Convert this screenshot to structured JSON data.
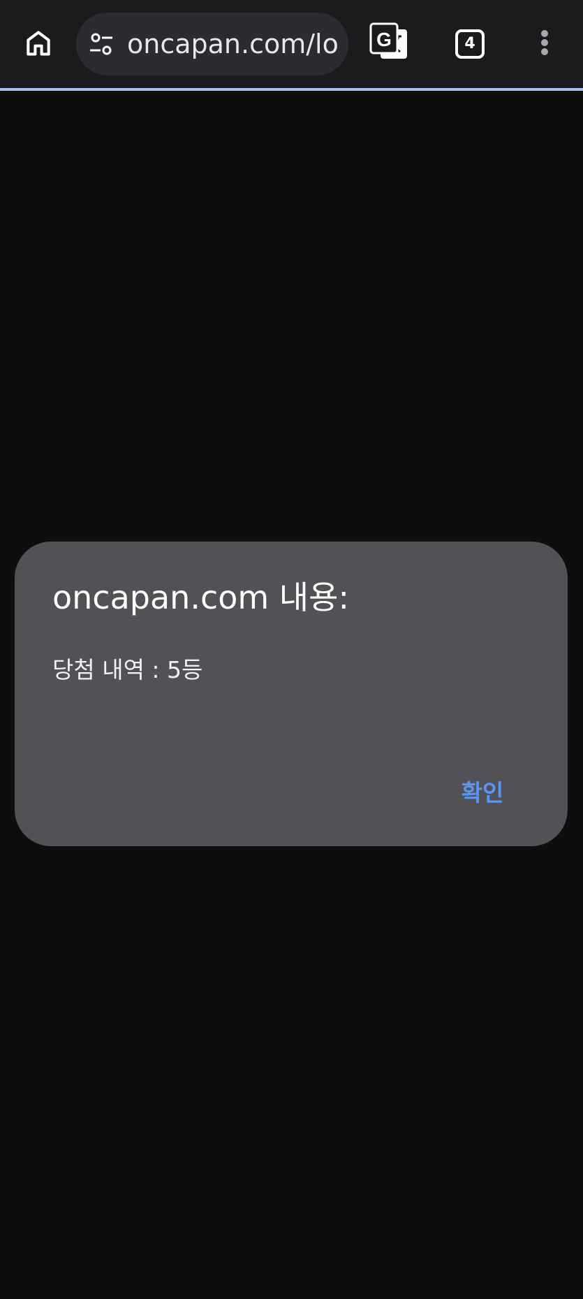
{
  "browser": {
    "url": "oncapan.com/lo",
    "tab_count": "4",
    "icons": {
      "home": "home-icon",
      "site_settings": "tune-icon",
      "translate": "translate-icon",
      "tabs": "tab-switcher-icon",
      "menu": "more-vert-icon"
    },
    "progress_fraction": 1.0
  },
  "dialog": {
    "title": "oncapan.com 내용:",
    "message": "당첨 내역 : 5등",
    "ok_label": "확인"
  },
  "colors": {
    "toolbar_bg": "#1b1b1d",
    "page_bg": "#0e0e0f",
    "dialog_bg": "#525256",
    "accent": "#5a95f5",
    "progress": "#a8c1f5"
  }
}
